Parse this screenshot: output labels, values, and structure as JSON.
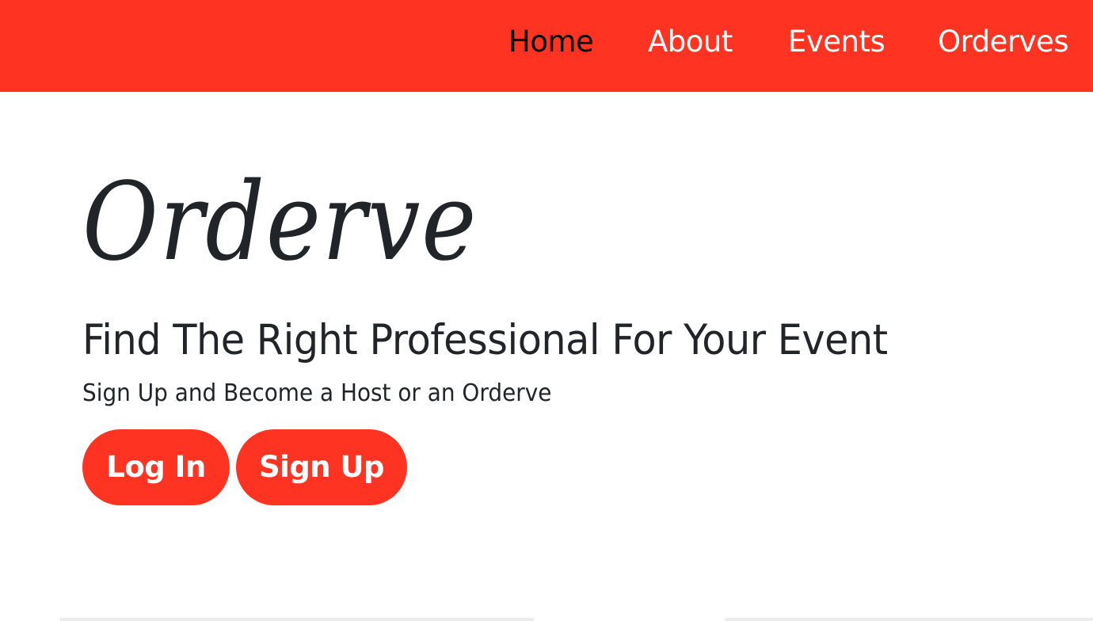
{
  "nav": {
    "items": [
      {
        "label": "Home",
        "active": true
      },
      {
        "label": "About",
        "active": false
      },
      {
        "label": "Events",
        "active": false
      },
      {
        "label": "Orderves",
        "active": false
      }
    ]
  },
  "hero": {
    "brand": "Orderve",
    "headline": "Find The Right Professional For Your Event",
    "subline": "Sign Up and Become a Host or an Orderve",
    "login_label": "Log In",
    "signup_label": "Sign Up"
  },
  "colors": {
    "accent": "#ff3322",
    "text": "#212529",
    "nav_active": "#000000",
    "nav_inactive": "#ffffff"
  }
}
